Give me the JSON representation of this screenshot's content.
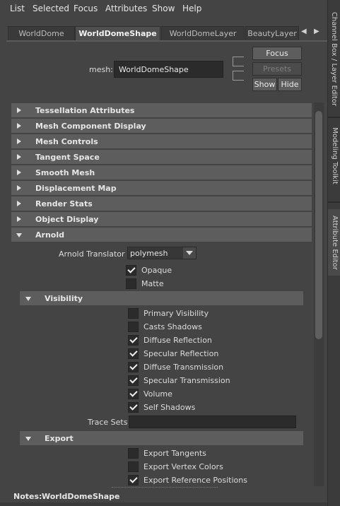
{
  "menu": [
    "List",
    "Selected",
    "Focus",
    "Attributes",
    "Show",
    "Help"
  ],
  "dock_tabs": [
    "Channel Box / Layer Editor",
    "Modeling Toolkit",
    "Attribute Editor"
  ],
  "tabs": [
    {
      "label": "WorldDome",
      "active": false
    },
    {
      "label": "WorldDomeShape",
      "active": true
    },
    {
      "label": "WorldDomeLayer",
      "active": false
    },
    {
      "label": "BeautyLayer",
      "active": false
    }
  ],
  "tab_arrows": {
    "left": "◀",
    "right": "▶"
  },
  "header": {
    "mesh_label": "mesh:",
    "mesh_value": "WorldDomeShape",
    "focus_label": "Focus",
    "presets_label": "Presets",
    "show_label": "Show",
    "hide_label": "Hide"
  },
  "sections": [
    {
      "label": "Tessellation Attributes",
      "open": false
    },
    {
      "label": "Mesh Component Display",
      "open": false
    },
    {
      "label": "Mesh Controls",
      "open": false
    },
    {
      "label": "Tangent Space",
      "open": false
    },
    {
      "label": "Smooth Mesh",
      "open": false
    },
    {
      "label": "Displacement Map",
      "open": false
    },
    {
      "label": "Render Stats",
      "open": false
    },
    {
      "label": "Object Display",
      "open": false
    },
    {
      "label": "Arnold",
      "open": true
    }
  ],
  "arnold": {
    "translator_label": "Arnold Translator",
    "translator_value": "polymesh",
    "opaque": {
      "label": "Opaque",
      "checked": true
    },
    "matte": {
      "label": "Matte",
      "checked": false
    },
    "visibility_label": "Visibility",
    "visibility": [
      {
        "label": "Primary Visibility",
        "checked": false
      },
      {
        "label": "Casts Shadows",
        "checked": false
      },
      {
        "label": "Diffuse Reflection",
        "checked": true
      },
      {
        "label": "Specular Reflection",
        "checked": true
      },
      {
        "label": "Diffuse Transmission",
        "checked": true
      },
      {
        "label": "Specular Transmission",
        "checked": true
      },
      {
        "label": "Volume",
        "checked": true
      },
      {
        "label": "Self Shadows",
        "checked": true
      }
    ],
    "trace_sets_label": "Trace Sets",
    "trace_sets_value": "",
    "export_label": "Export",
    "export": [
      {
        "label": "Export Tangents",
        "checked": false
      },
      {
        "label": "Export Vertex Colors",
        "checked": false
      },
      {
        "label": "Export Reference Positions",
        "checked": true
      }
    ]
  },
  "notes": {
    "label": "Notes:",
    "value": "WorldDomeShape"
  },
  "colors": {
    "background": "#444444",
    "field": "#2b2b2b",
    "section": "#5d5d5d"
  }
}
